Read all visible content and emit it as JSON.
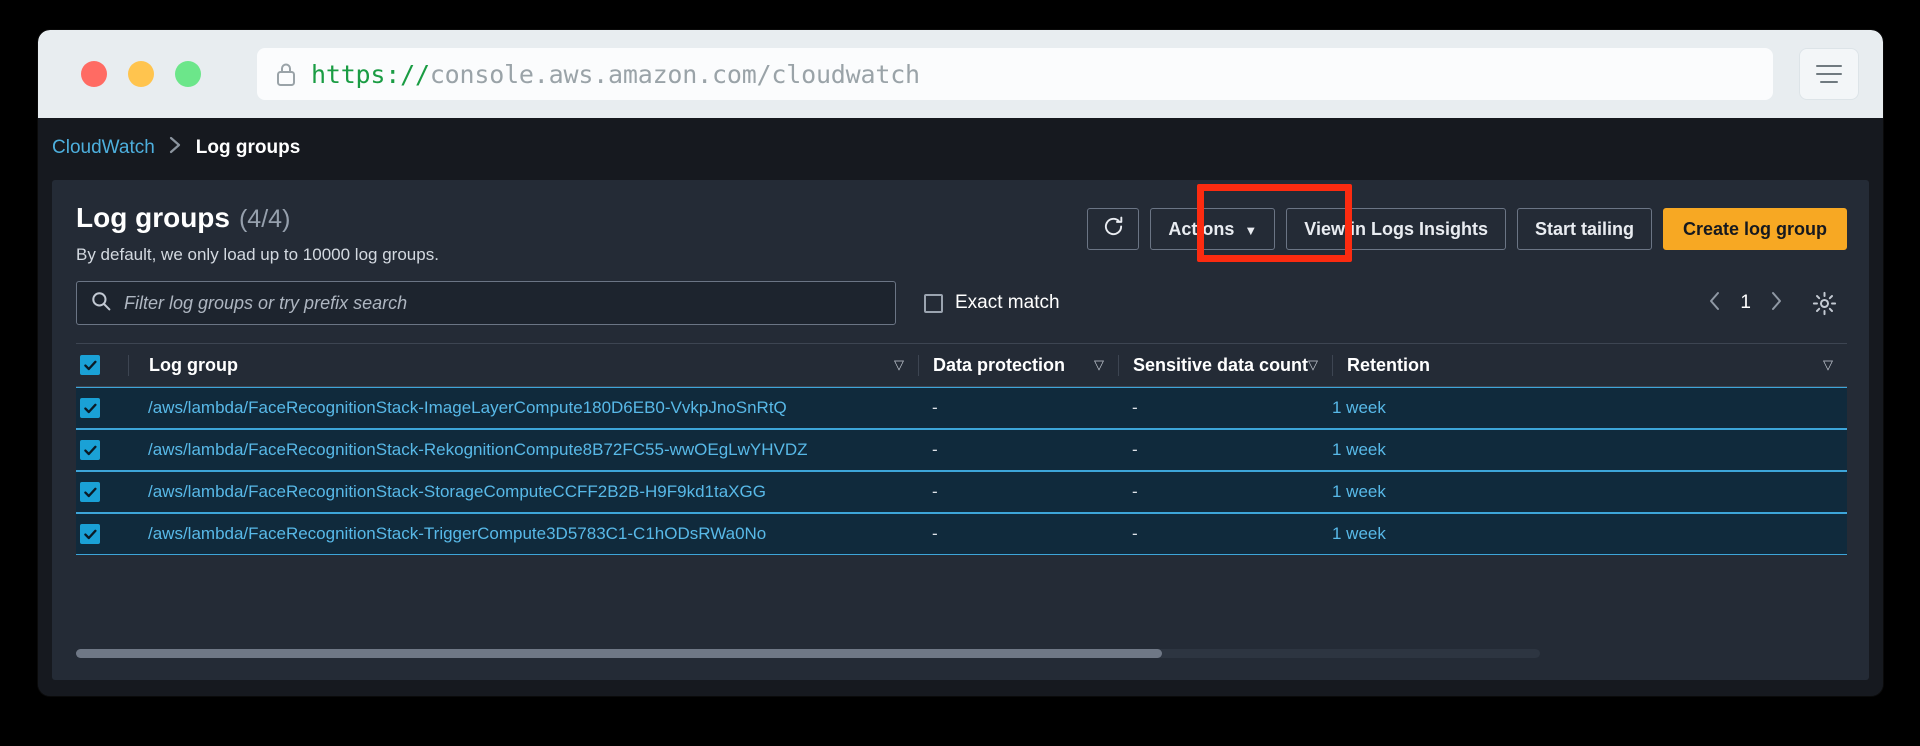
{
  "browser": {
    "url_scheme": "https://",
    "url_rest": "console.aws.amazon.com/cloudwatch",
    "lock_icon": "lock-icon",
    "menu_icon": "hamburger-menu-icon"
  },
  "breadcrumb": {
    "root": "CloudWatch",
    "separator": "›",
    "current": "Log groups"
  },
  "panel": {
    "title": "Log groups",
    "count": "(4/4)",
    "subtitle": "By default, we only load up to 10000 log groups."
  },
  "toolbar": {
    "refresh_label": "refresh-icon",
    "actions_label": "Actions",
    "actions_caret": "▼",
    "view_insights_label": "View in Logs Insights",
    "start_tailing_label": "Start tailing",
    "create_log_group_label": "Create log group",
    "highlight_color": "#fc2b10",
    "primary_color": "#f7a823"
  },
  "search": {
    "placeholder": "Filter log groups or try prefix search",
    "value": "",
    "exact_match_label": "Exact match",
    "exact_match_checked": false
  },
  "pagination": {
    "prev": "‹",
    "page": "1",
    "next": "›",
    "settings_icon": "gear-icon"
  },
  "table": {
    "columns": [
      {
        "label": "Log group",
        "sort": "▽"
      },
      {
        "label": "Data protection",
        "sort": "▽"
      },
      {
        "label": "Sensitive data count",
        "sort": "▽"
      },
      {
        "label": "Retention",
        "sort": "▽"
      }
    ],
    "select_all_checked": true,
    "rows": [
      {
        "name": "/aws/lambda/FaceRecognitionStack-ImageLayerCompute180D6EB0-VvkpJnoSnRtQ",
        "data_protection": "-",
        "sensitive_data_count": "-",
        "retention": "1 week",
        "selected": true
      },
      {
        "name": "/aws/lambda/FaceRecognitionStack-RekognitionCompute8B72FC55-wwOEgLwYHVDZ",
        "data_protection": "-",
        "sensitive_data_count": "-",
        "retention": "1 week",
        "selected": true
      },
      {
        "name": "/aws/lambda/FaceRecognitionStack-StorageComputeCCFF2B2B-H9F9kd1taXGG",
        "data_protection": "-",
        "sensitive_data_count": "-",
        "retention": "1 week",
        "selected": true
      },
      {
        "name": "/aws/lambda/FaceRecognitionStack-TriggerCompute3D5783C1-C1hODsRWa0No",
        "data_protection": "-",
        "sensitive_data_count": "-",
        "retention": "1 week",
        "selected": true
      }
    ]
  }
}
